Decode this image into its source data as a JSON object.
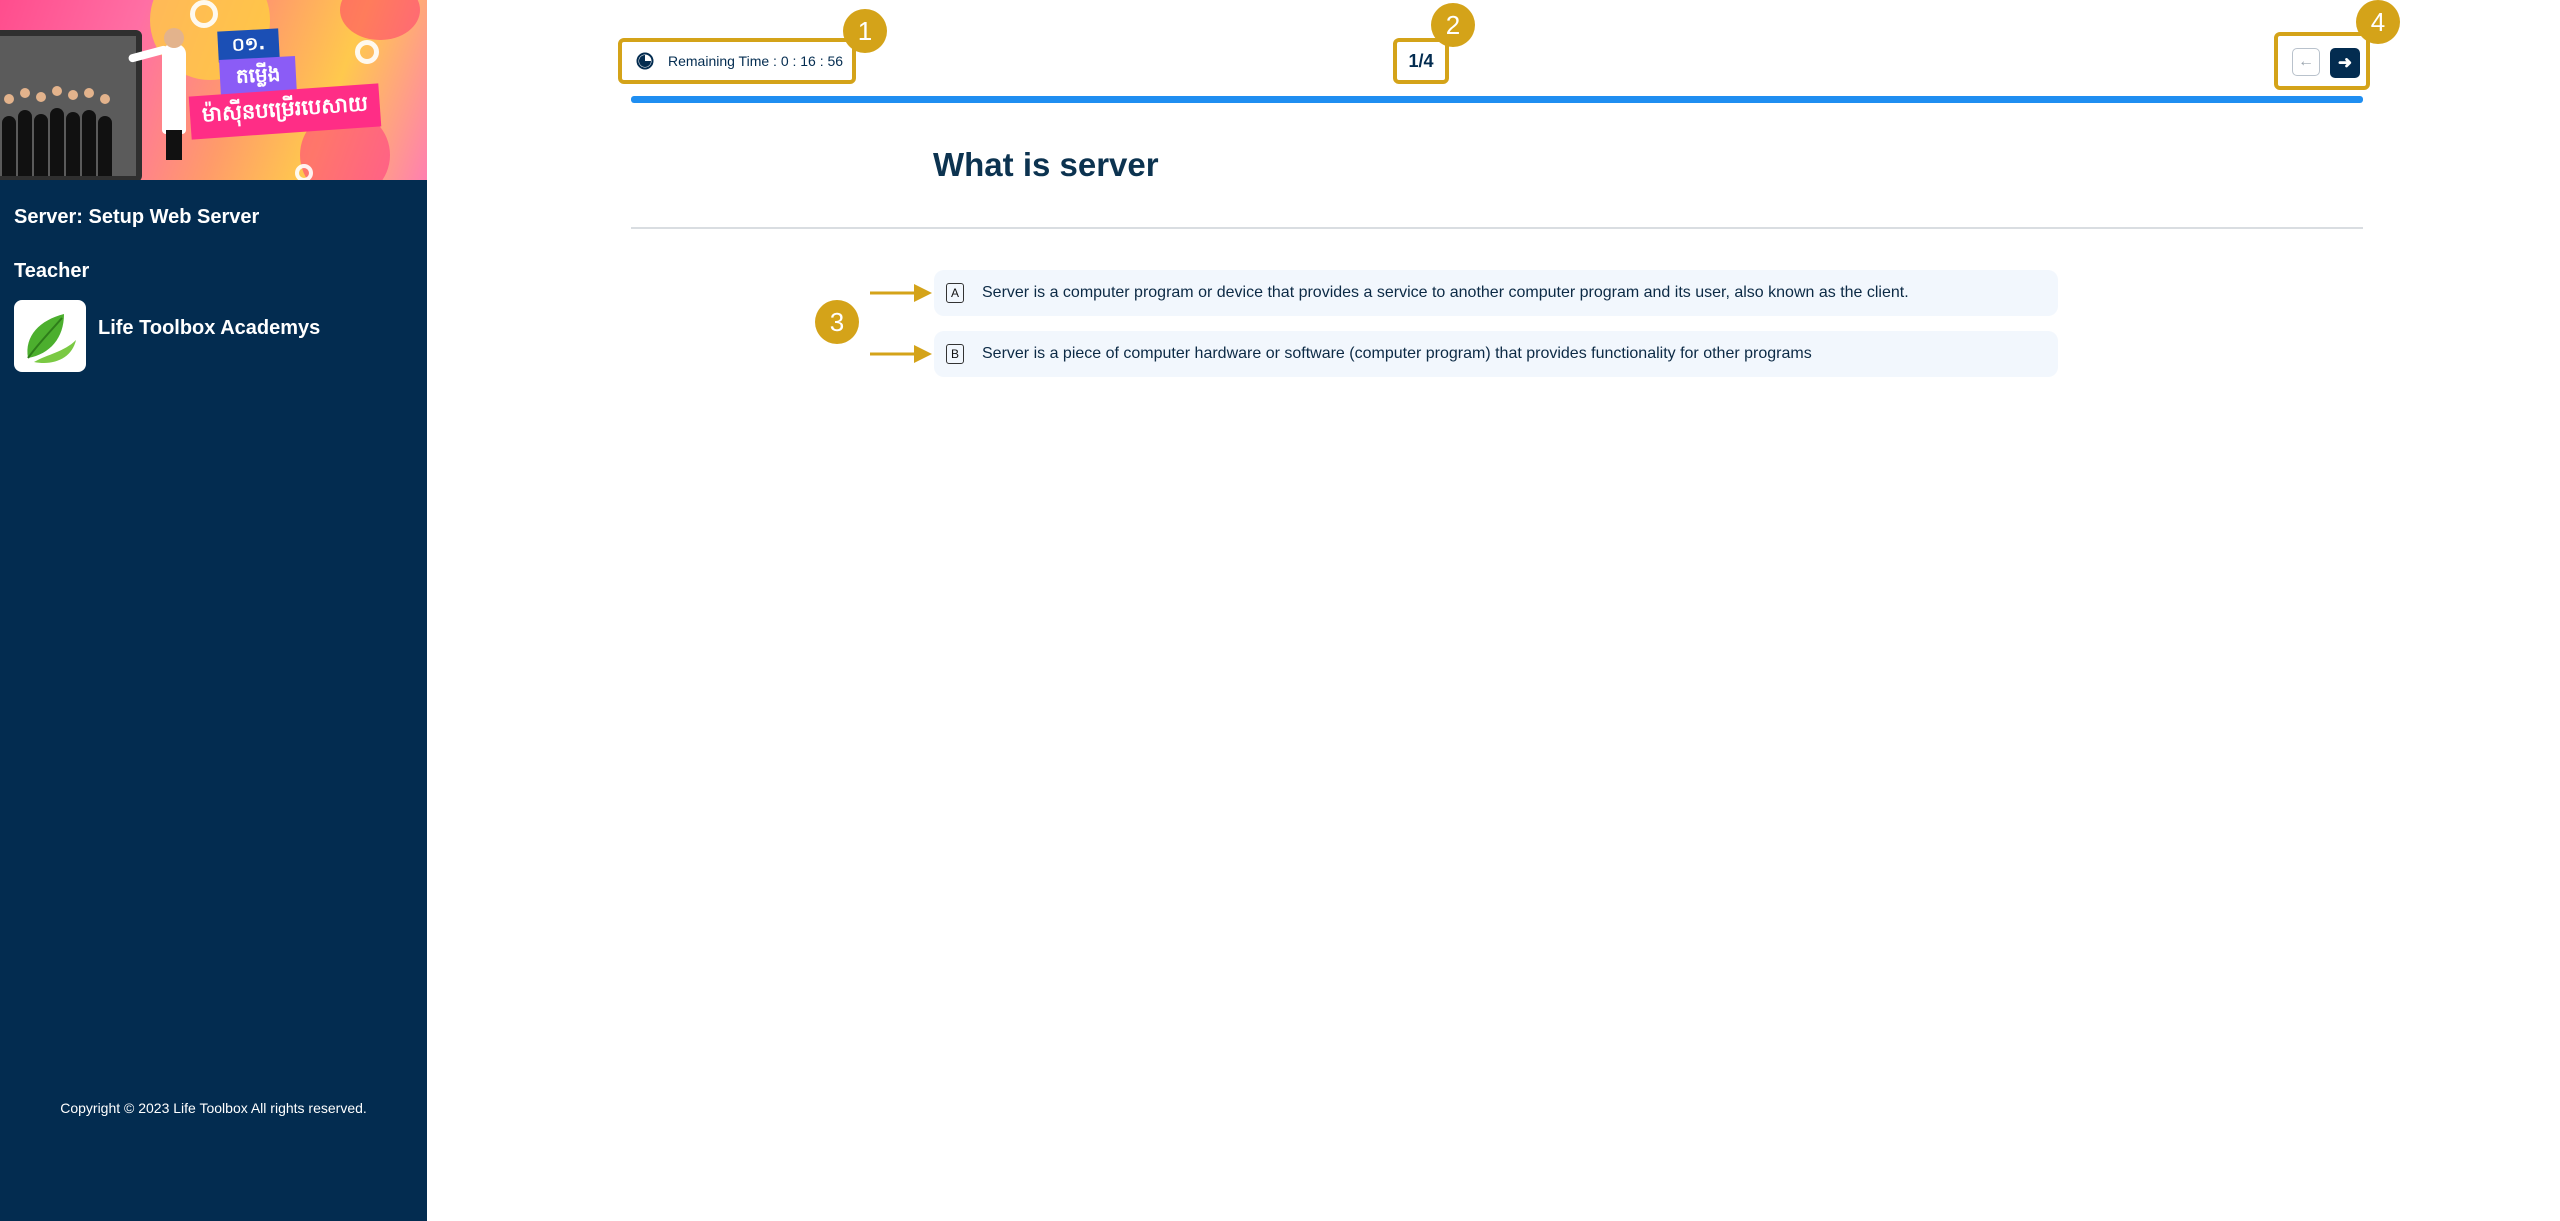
{
  "sidebar": {
    "banner_texts": [
      "០១.",
      "តម្លើង",
      "ម៉ាស៊ីនបម្រើរបេសាយ"
    ],
    "course_title": "Server: Setup Web Server",
    "teacher_label": "Teacher",
    "teacher_name": "Life Toolbox Academys",
    "copyright": "Copyright © 2023 Life Toolbox All rights reserved."
  },
  "quiz": {
    "timer_text": "Remaining Time : 0 : 16 : 56",
    "counter": "1/4",
    "progress": 1.0,
    "question": "What is server",
    "answers": [
      {
        "letter": "A",
        "text": "Server is a computer program or device that provides a service to another computer program and its user, also known as the client."
      },
      {
        "letter": "B",
        "text": "Server is a piece of computer hardware or software (computer program) that provides functionality for other programs"
      }
    ]
  },
  "nav": {
    "prev_icon": "arrow-left-icon",
    "next_icon": "arrow-right-icon"
  },
  "annotations": {
    "badges": [
      "1",
      "2",
      "3",
      "4"
    ],
    "color": "#d4a319"
  },
  "colors": {
    "sidebar_bg": "#032c50",
    "progress": "#1f8ef1",
    "accent": "#d4a319"
  }
}
